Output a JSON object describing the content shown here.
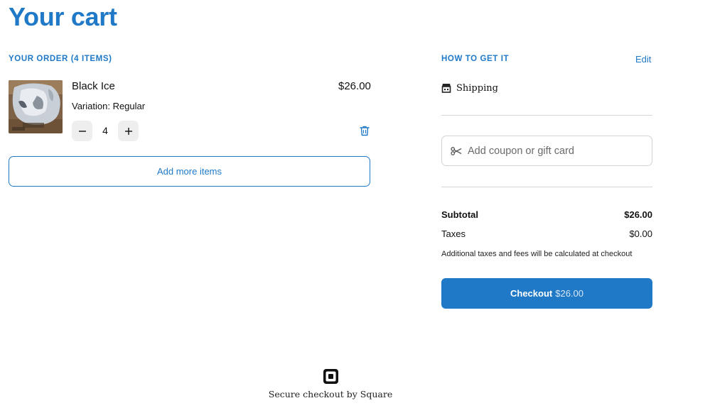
{
  "page": {
    "title": "Your cart"
  },
  "order": {
    "heading": "YOUR ORDER (4 ITEMS)",
    "items": [
      {
        "name": "Black Ice",
        "price": "$26.00",
        "variation": "Variation: Regular",
        "quantity": "4",
        "thumbnail_icon": "product-photo"
      }
    ],
    "add_more_label": "Add more items"
  },
  "fulfillment": {
    "heading": "HOW TO GET IT",
    "edit_label": "Edit",
    "method_label": "Shipping",
    "method_icon": "storefront-icon"
  },
  "coupon": {
    "placeholder": "Add coupon or gift card",
    "icon": "scissors-icon"
  },
  "summary": {
    "subtotal_label": "Subtotal",
    "subtotal_value": "$26.00",
    "taxes_label": "Taxes",
    "taxes_value": "$0.00",
    "note": "Additional taxes and fees will be calculated at checkout"
  },
  "checkout": {
    "label": "Checkout",
    "amount": "$26.00"
  },
  "footer": {
    "text": "Secure checkout by Square",
    "logo_icon": "square-logo-icon"
  },
  "colors": {
    "accent": "#2079c7",
    "checkout_bg": "#2079c7",
    "qty_button_bg": "#eeeeee",
    "divider": "#d6d6d6"
  }
}
